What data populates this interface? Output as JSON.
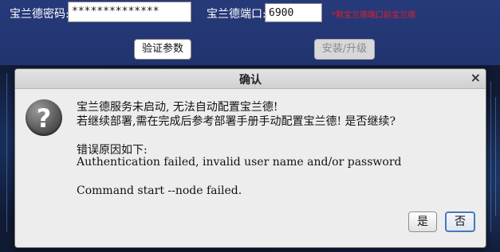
{
  "form": {
    "password_label": "宝兰德密码:",
    "password_value": "**************",
    "port_label": "宝兰德端口:",
    "port_value": "6900",
    "port_hint": "*默宝兰德端口前宝兰德"
  },
  "buttons": {
    "verify_label": "验证参数",
    "install_label": "安装/升级"
  },
  "dialog": {
    "title": "确认",
    "close_glyph": "×",
    "question_glyph": "?",
    "line1": "宝兰德服务未启动, 无法自动配置宝兰德!",
    "line2": "若继续部署,需在完成后参考部署手册手动配置宝兰德! 是否继续?",
    "line3": "错误原因如下:",
    "line4": "Authentication failed, invalid user name and/or password",
    "line5": "Command start --node failed.",
    "yes_label": "是",
    "no_label": "否"
  }
}
